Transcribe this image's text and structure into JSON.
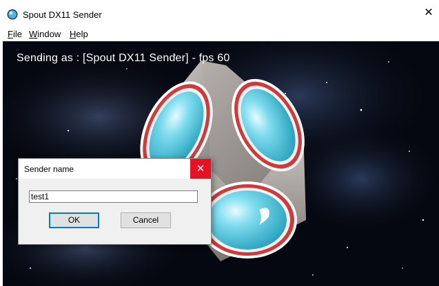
{
  "window": {
    "title": "Spout DX11 Sender",
    "close_glyph": "✕"
  },
  "menu": {
    "items": [
      {
        "label_ul": "F",
        "label_rest": "ile"
      },
      {
        "label_ul": "W",
        "label_rest": "indow"
      },
      {
        "label_ul": "H",
        "label_rest": "elp"
      }
    ]
  },
  "viewport": {
    "status": "Sending as : [Spout DX11 Sender] - fps 60"
  },
  "dialog": {
    "title": "Sender name",
    "close_glyph": "✕",
    "input_value": "test1",
    "ok_label": "OK",
    "cancel_label": "Cancel"
  },
  "colors": {
    "accent_close": "#e81123",
    "focus_border": "#0078d7",
    "viewport_bg": "#050810"
  },
  "icons": [
    "app-logo-icon",
    "close-icon",
    "dialog-close-icon"
  ]
}
